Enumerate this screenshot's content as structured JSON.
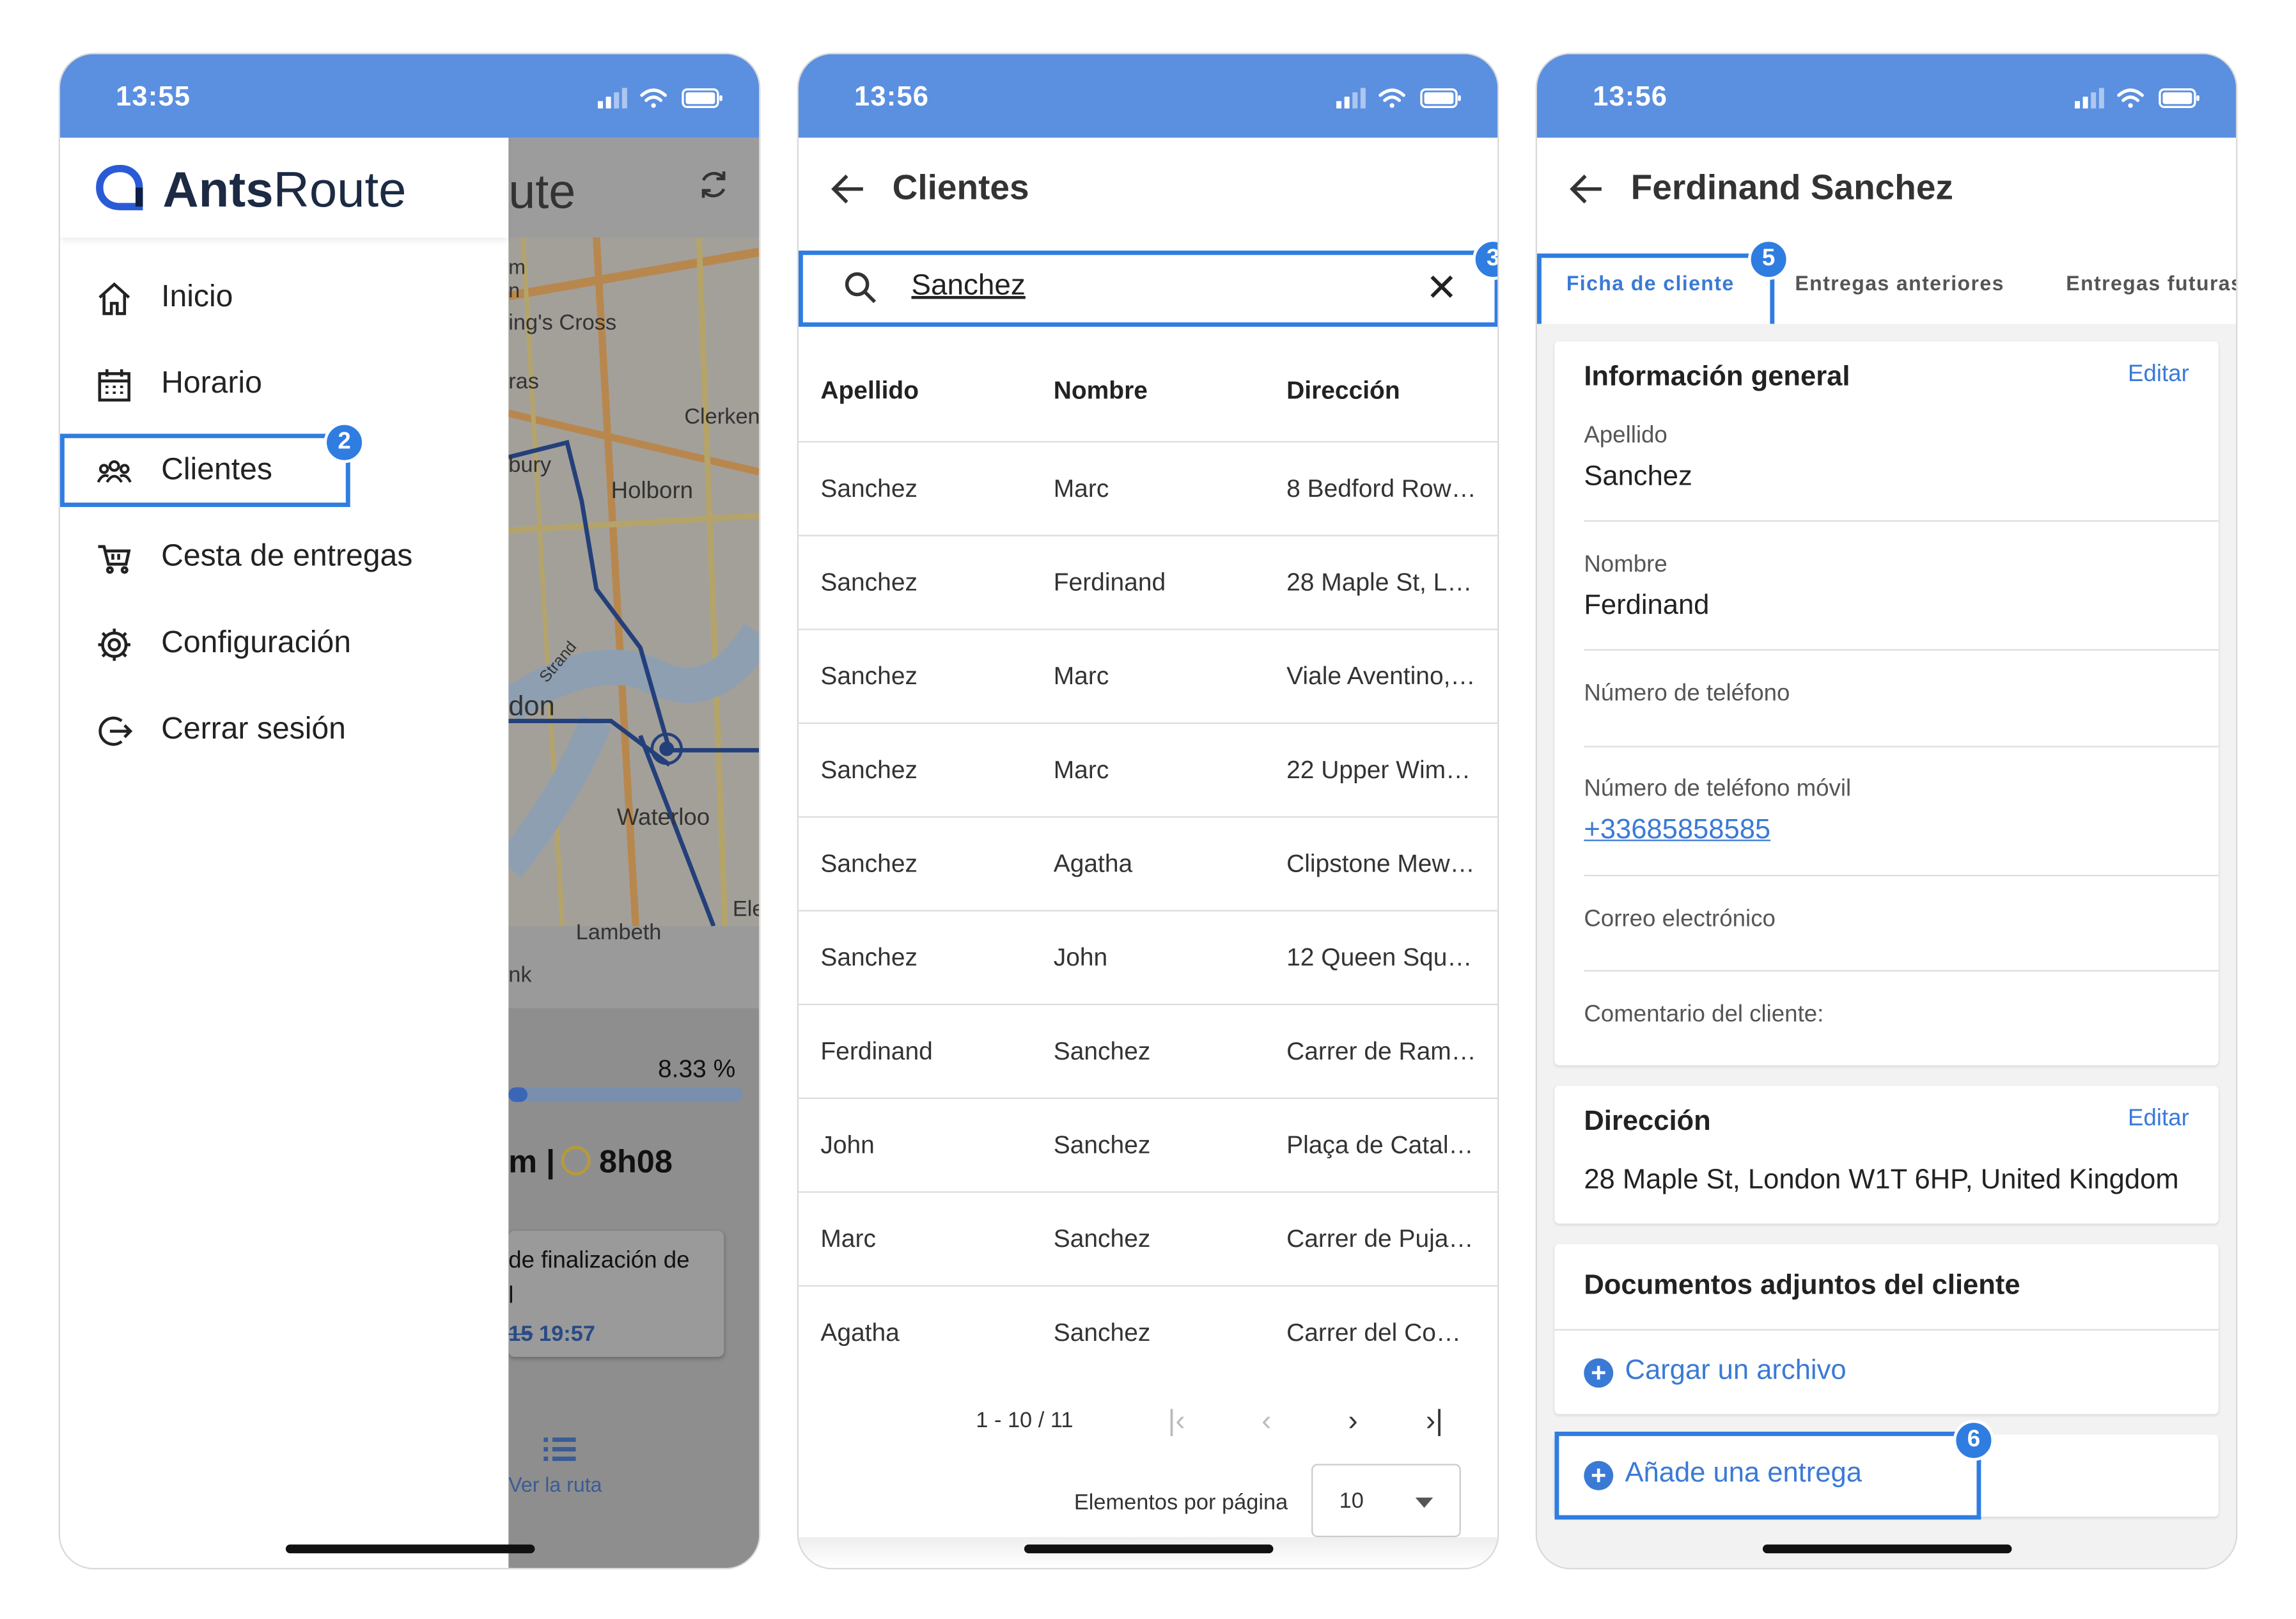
{
  "colors": {
    "status_bar": "#5b8fe0",
    "accent": "#3a7ad6",
    "callout": "#2f7de1"
  },
  "phone1": {
    "time": "13:55",
    "map": {
      "title_partial": "ute",
      "labels": [
        "ing's Cross",
        "Clerken",
        "Holborn",
        "ras",
        "bury",
        "don",
        "Waterloo",
        "Lambeth",
        "Ele",
        "nk",
        "m",
        "n",
        "Strand"
      ],
      "progress_text": "8.33 %",
      "progress_fraction": 0.0833,
      "km_partial": "m |",
      "duration": "8h08",
      "card_line1": "de finalización de",
      "card_line2": "l",
      "card_time_prefix": "15",
      "card_time": "19:57",
      "ver_ruta": "Ver la ruta"
    },
    "logo": {
      "bold": "Ants",
      "rest": "Route"
    },
    "menu": [
      {
        "label": "Inicio",
        "icon": "home-icon"
      },
      {
        "label": "Horario",
        "icon": "calendar-icon"
      },
      {
        "label": "Clientes",
        "icon": "clients-icon"
      },
      {
        "label": "Cesta de entregas",
        "icon": "cart-icon"
      },
      {
        "label": "Configuración",
        "icon": "gear-icon"
      },
      {
        "label": "Cerrar sesión",
        "icon": "logout-icon"
      }
    ],
    "badge": "2"
  },
  "phone2": {
    "time": "13:56",
    "title": "Clientes",
    "search_value": "Sanchez",
    "clear_glyph": "✕",
    "badge": "3",
    "columns": [
      "Apellido",
      "Nombre",
      "Dirección"
    ],
    "rows": [
      [
        "Sanchez",
        "Marc",
        "8 Bedford Row…"
      ],
      [
        "Sanchez",
        "Ferdinand",
        "28 Maple St, L…"
      ],
      [
        "Sanchez",
        "Marc",
        "Viale Aventino,…"
      ],
      [
        "Sanchez",
        "Marc",
        "22 Upper Wim…"
      ],
      [
        "Sanchez",
        "Agatha",
        "Clipstone Mew…"
      ],
      [
        "Sanchez",
        "John",
        "12 Queen Squ…"
      ],
      [
        "Ferdinand",
        "Sanchez",
        "Carrer de Ram…"
      ],
      [
        "John",
        "Sanchez",
        "Plaça de Catal…"
      ],
      [
        "Marc",
        "Sanchez",
        "Carrer de Puja…"
      ],
      [
        "Agatha",
        "Sanchez",
        "Carrer del Co…"
      ]
    ],
    "pagination": {
      "range": "1 - 10 / 11",
      "first": "|‹",
      "prev": "‹",
      "next": "›",
      "last": "›|"
    },
    "per_page_label": "Elementos por página",
    "per_page_value": "10"
  },
  "phone3": {
    "time": "13:56",
    "title": "Ferdinand Sanchez",
    "tabs": [
      "Ficha de cliente",
      "Entregas anteriores",
      "Entregas futuras"
    ],
    "badge_tab": "5",
    "general": {
      "title": "Información general",
      "edit": "Editar",
      "fields": [
        {
          "label": "Apellido",
          "value": "Sanchez"
        },
        {
          "label": "Nombre",
          "value": "Ferdinand"
        },
        {
          "label": "Número de teléfono",
          "value": ""
        },
        {
          "label": "Número de teléfono móvil",
          "value": "+33685858585"
        },
        {
          "label": "Correo electrónico",
          "value": ""
        },
        {
          "label": "Comentario del cliente:",
          "value": ""
        }
      ]
    },
    "address": {
      "title": "Dirección",
      "edit": "Editar",
      "value": "28 Maple St, London W1T 6HP, United Kingdom"
    },
    "documents": {
      "title": "Documentos adjuntos del cliente",
      "upload": "Cargar un archivo"
    },
    "add_delivery": "Añade una entrega",
    "badge_add": "6"
  }
}
